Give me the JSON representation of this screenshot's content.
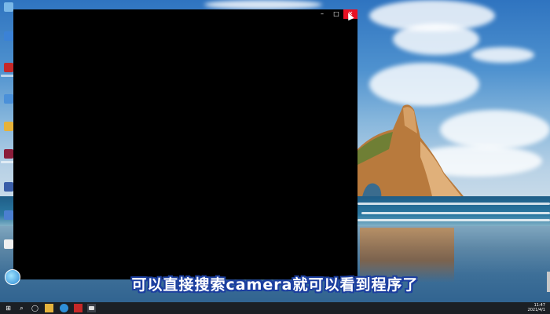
{
  "window": {
    "minimize_glyph": "–",
    "maximize_glyph": "□",
    "close_glyph": "✕"
  },
  "subtitle": "可以直接搜索camera就可以看到程序了",
  "taskbar": {
    "start_glyph": "⊞",
    "search_glyph": "⌕",
    "taskview_glyph": "◯",
    "clock_time": "11:47",
    "clock_date": "2021/4/1"
  },
  "colors": {
    "subtitle_outline": "#1c3fa0",
    "close_button": "#e81123",
    "taskbar": "#1b1f24"
  }
}
